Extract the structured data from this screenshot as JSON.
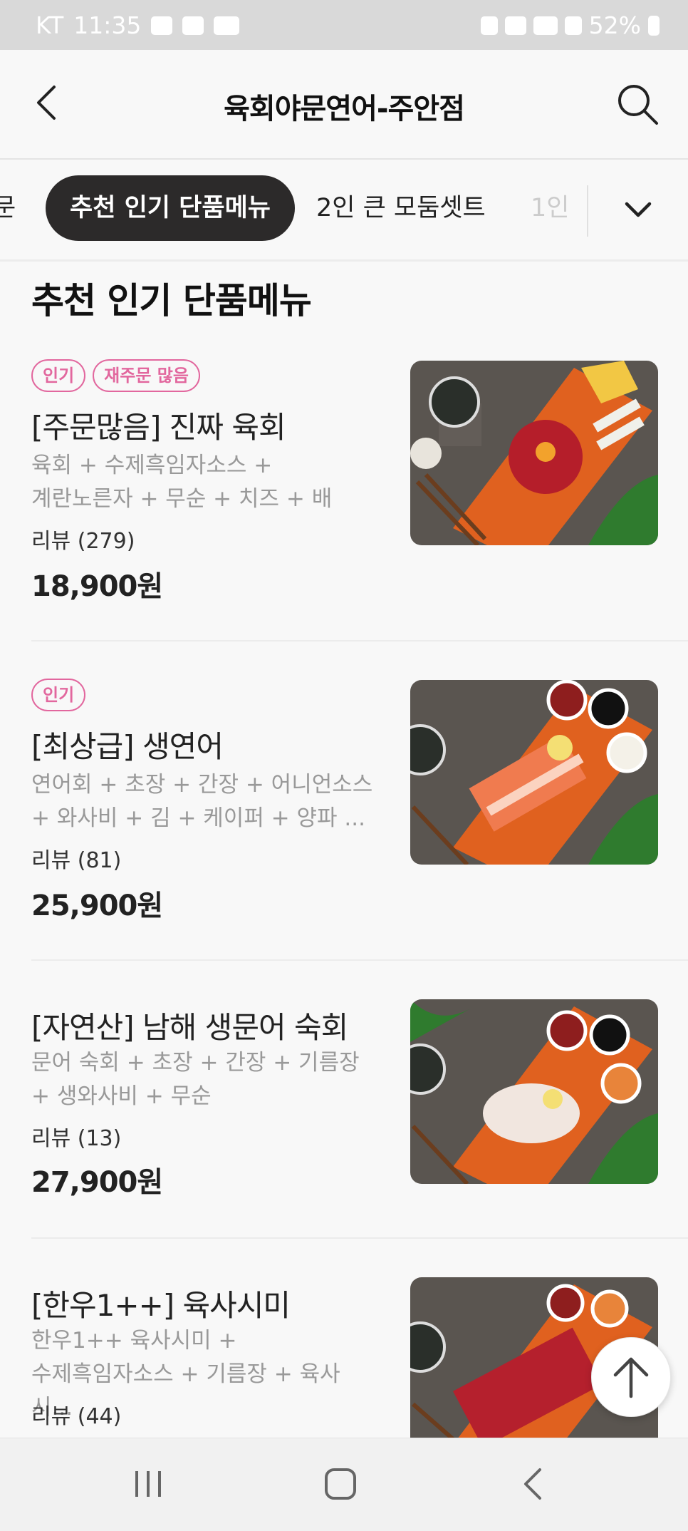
{
  "status_bar": {
    "carrier": "KT",
    "time": "11:35",
    "battery": "52%"
  },
  "header": {
    "title": "육회야문연어-주안점"
  },
  "tabs": [
    {
      "label": "문"
    },
    {
      "label": "추천 인기 단품메뉴"
    },
    {
      "label": "2인 큰 모둠셋트"
    },
    {
      "label": "1인"
    }
  ],
  "section": {
    "title": "추천 인기 단품메뉴"
  },
  "menu": [
    {
      "badges": [
        "인기",
        "재주문 많음"
      ],
      "name": "[주문많음] 진짜 육회",
      "desc_line1": "육회 + 수제흑임자소스 +",
      "desc_line2": "계란노른자 + 무순 + 치즈 + 배",
      "reviews": "리뷰 (279)",
      "price": "18,900원"
    },
    {
      "badges": [
        "인기"
      ],
      "name": "[최상급] 생연어",
      "desc_line1": "연어회 + 초장 + 간장 + 어니언소스",
      "desc_line2": "+ 와사비 + 김 + 케이퍼 + 양파 ...",
      "reviews": "리뷰 (81)",
      "price": "25,900원"
    },
    {
      "badges": [],
      "name": "[자연산] 남해 생문어 숙회",
      "desc_line1": "문어 숙회 + 초장 + 간장 + 기름장",
      "desc_line2": "+ 생와사비 + 무순",
      "reviews": "리뷰 (13)",
      "price": "27,900원"
    },
    {
      "badges": [],
      "name": "[한우1++] 육사시미",
      "desc_line1": "한우1++ 육사시미 +",
      "desc_line2": "수제흑임자소스 + 기름장 + 육사시...",
      "reviews": "리뷰 (44)",
      "price": ""
    }
  ],
  "colors": {
    "accent_pink": "#e2679e",
    "active_tab_bg": "#2c2a2a",
    "board_orange": "#e0611f"
  }
}
